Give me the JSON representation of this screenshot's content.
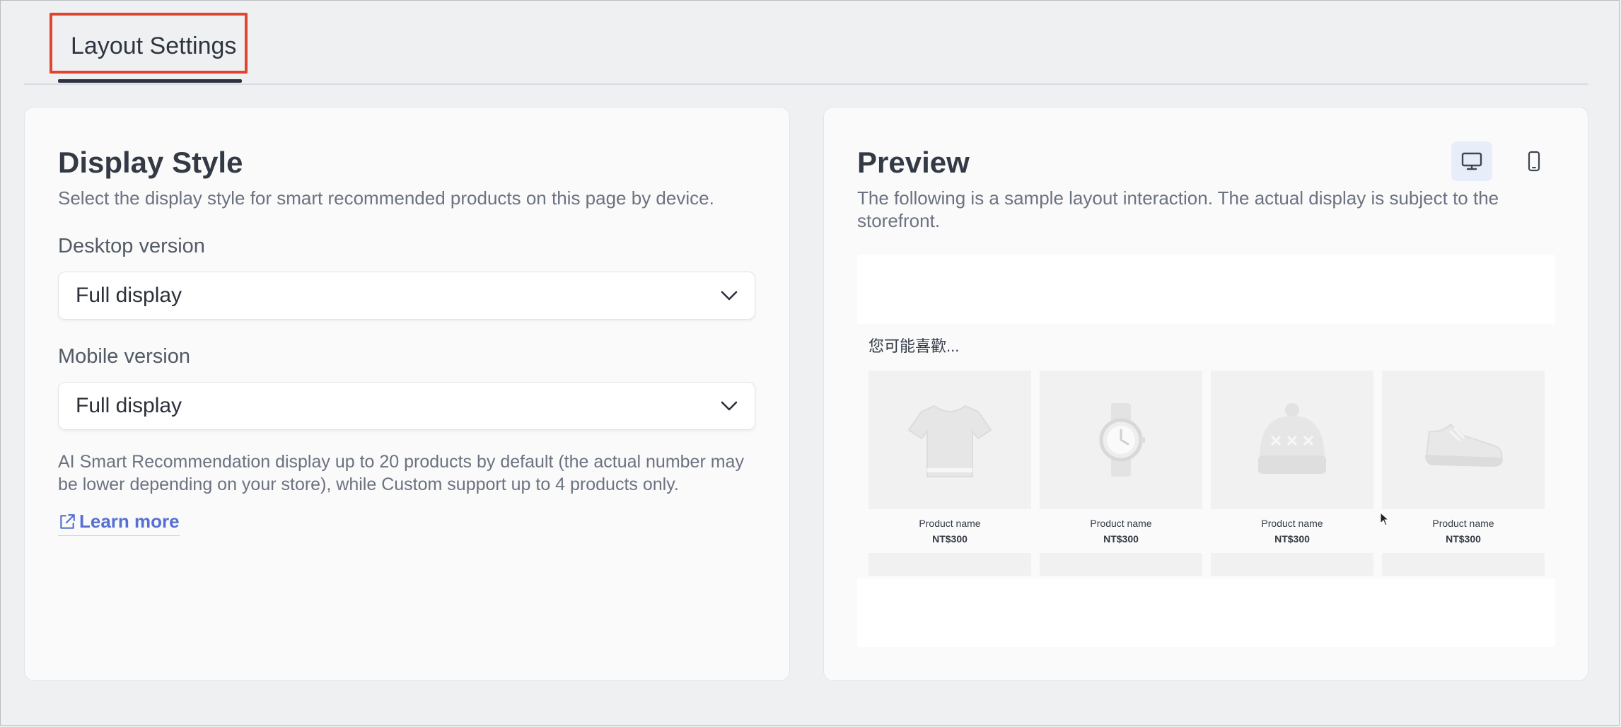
{
  "tabs": [
    {
      "label": "Layout Settings",
      "active": true
    }
  ],
  "display_style": {
    "title": "Display Style",
    "subtitle": "Select the display style for smart recommended products on this page by device.",
    "desktop": {
      "label": "Desktop version",
      "value": "Full display"
    },
    "mobile": {
      "label": "Mobile version",
      "value": "Full display"
    },
    "note": "AI Smart Recommendation display up to 20 products by default (the actual number may be lower depending on your store), while Custom support up to 4 products only.",
    "learn_more": "Learn more"
  },
  "preview": {
    "title": "Preview",
    "subtitle": "The following is a sample layout interaction. The actual display is subject to the storefront.",
    "selected_device": "desktop",
    "heading": "您可能喜歡...",
    "products": [
      {
        "name": "Product name",
        "price": "NT$300",
        "icon": "tshirt-icon"
      },
      {
        "name": "Product name",
        "price": "NT$300",
        "icon": "watch-icon"
      },
      {
        "name": "Product name",
        "price": "NT$300",
        "icon": "beanie-icon"
      },
      {
        "name": "Product name",
        "price": "NT$300",
        "icon": "sneaker-icon"
      }
    ]
  },
  "colors": {
    "accent": "#5670d3",
    "highlight": "#e2442f",
    "text": "#333a45",
    "muted": "#6b7280"
  }
}
